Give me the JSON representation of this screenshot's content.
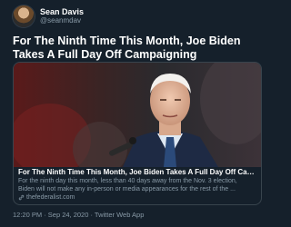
{
  "author": {
    "name": "Sean Davis",
    "handle": "@seanmdav"
  },
  "tweet": {
    "text": "For The Ninth Time This Month, Joe Biden Takes A Full Day Off Campaigning"
  },
  "card": {
    "title": "For The Ninth Time This Month, Joe Biden Takes A Full Day Off Campaigning",
    "description_line1": "For the ninth day this month, less than 40 days away from the Nov. 3 election,",
    "description_line2": "Biden will not make any in-person or media appearances for the rest of the ...",
    "domain": "thefederalist.com"
  },
  "timestamp": "12:20 PM · Sep 24, 2020 · Twitter Web App",
  "colors": {
    "background": "#15202b",
    "secondary_text": "#8899a6",
    "border": "#38444d"
  }
}
